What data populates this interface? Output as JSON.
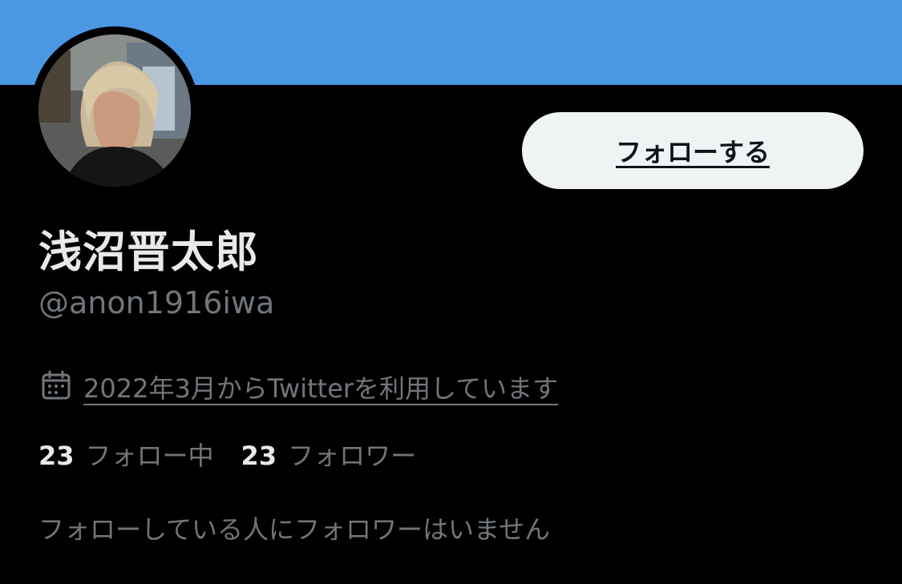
{
  "profile": {
    "display_name": "浅沼晋太郎",
    "handle": "@anon1916iwa",
    "joined": "2022年3月からTwitterを利用しています"
  },
  "actions": {
    "follow_label": "フォローする"
  },
  "stats": {
    "following_count": "23",
    "following_label": "フォロー中",
    "followers_count": "23",
    "followers_label": "フォロワー"
  },
  "mutuals_note": "フォローしている人にフォロワーはいません",
  "icons": {
    "calendar": "calendar-icon"
  },
  "colors": {
    "banner": "#4a97e3",
    "background": "#000000",
    "primary_text": "#e7e9ea",
    "secondary_text": "#71767b",
    "follow_button_bg": "#eff3f4"
  }
}
